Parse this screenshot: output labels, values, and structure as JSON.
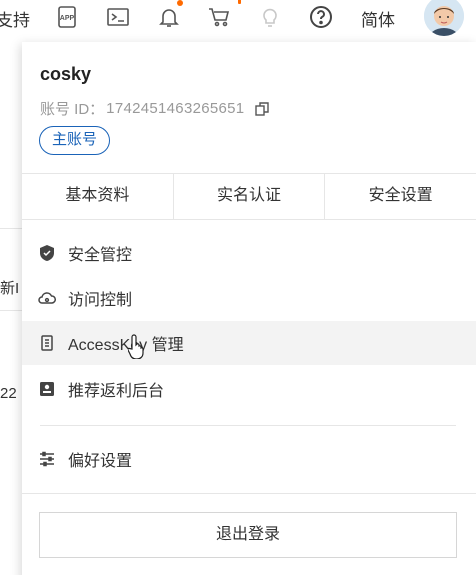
{
  "topbar": {
    "support_text": "支持",
    "lang_label": "简体",
    "icons": [
      "app-icon",
      "terminal-icon",
      "bell-icon",
      "cart-icon",
      "lightbulb-icon",
      "help-icon"
    ]
  },
  "background": {
    "text1": "新I",
    "text2": "22"
  },
  "panel": {
    "username": "cosky",
    "account_id_label": "账号 ID：",
    "account_id_value": "1742451463265651",
    "badge": "主账号",
    "tabs": [
      "基本资料",
      "实名认证",
      "安全设置"
    ],
    "menu": [
      {
        "label": "安全管控",
        "icon": "shield-icon"
      },
      {
        "label": "访问控制",
        "icon": "cloud-icon"
      },
      {
        "label": "AccessKey 管理",
        "icon": "key-icon"
      },
      {
        "label": "推荐返利后台",
        "icon": "rebate-icon"
      },
      {
        "label": "偏好设置",
        "icon": "sliders-icon"
      }
    ],
    "logout": "退出登录"
  },
  "colors": {
    "accent": "#1a63b8",
    "notify_dot": "#ff6a00"
  }
}
